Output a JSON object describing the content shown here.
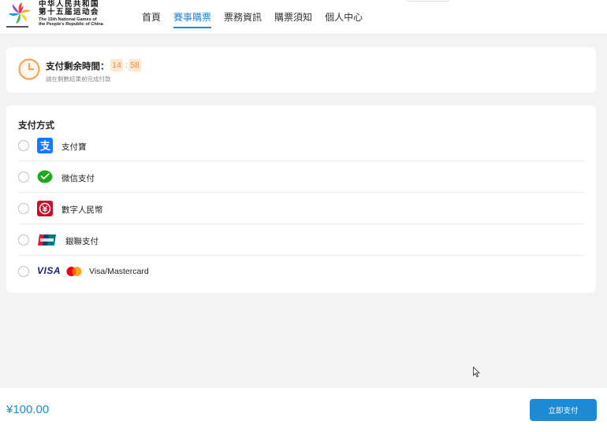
{
  "header": {
    "logo_cn": "中华人民共和国 第十五届运动会",
    "logo_en_line1": "The 15th National Games of",
    "logo_en_line2": "the People's Republic of China",
    "nav": [
      {
        "label": "首頁",
        "active": false
      },
      {
        "label": "賽事購票",
        "active": true
      },
      {
        "label": "票務資訊",
        "active": false
      },
      {
        "label": "購票須知",
        "active": false
      },
      {
        "label": "個人中心",
        "active": false
      }
    ]
  },
  "timer": {
    "label": "支付剩余時間：",
    "minutes": "14",
    "separator": ":",
    "seconds": "58",
    "hint": "請在剩數結果前完成付款"
  },
  "payment": {
    "title": "支付方式",
    "methods": [
      {
        "label": "支付寶",
        "icon": "alipay-icon"
      },
      {
        "label": "微信支付",
        "icon": "wechat-pay-icon"
      },
      {
        "label": "數字人民幣",
        "icon": "digital-rmb-icon"
      },
      {
        "label": "銀聯支付",
        "icon": "unionpay-icon"
      },
      {
        "label": "Visa/Mastercard",
        "icon": "visa-mastercard-icon",
        "visa_text": "VISA"
      }
    ]
  },
  "footer": {
    "price": "¥100.00",
    "pay_button": "立即支付"
  },
  "colors": {
    "accent": "#1d8ad3",
    "timer_bg": "#fde8d2",
    "timer_fg": "#ee8b3a",
    "page_bg": "#f3f3f4"
  }
}
